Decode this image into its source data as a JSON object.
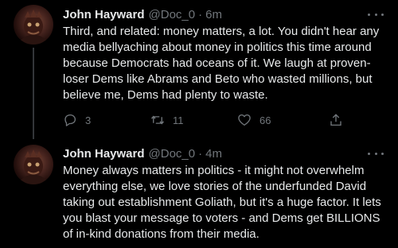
{
  "tweets": [
    {
      "name": "John Hayward",
      "handle": "@Doc_0",
      "separator": "·",
      "time": "6m",
      "text": "Third, and related: money matters, a lot. You didn't hear any media bellyaching about money in politics this time around because Democrats had oceans of it. We laugh at proven-loser Dems like Abrams and Beto who wasted millions, but believe me, Dems had plenty to waste.",
      "replies": "3",
      "retweets": "11",
      "likes": "66"
    },
    {
      "name": "John Hayward",
      "handle": "@Doc_0",
      "separator": "·",
      "time": "4m",
      "text": "Money always matters in politics - it might not overwhelm everything else, we love stories of the underfunded David taking out establishment Goliath, but it's a huge factor. It lets you blast your message to voters - and Dems get BILLIONS of in-kind donations from their media."
    }
  ],
  "icons": {
    "reply": "reply-icon",
    "retweet": "retweet-icon",
    "like": "like-icon",
    "share": "share-icon",
    "more": "more-icon"
  },
  "colors": {
    "background": "#000000",
    "text": "#e7e9ea",
    "secondary": "#71767b"
  }
}
